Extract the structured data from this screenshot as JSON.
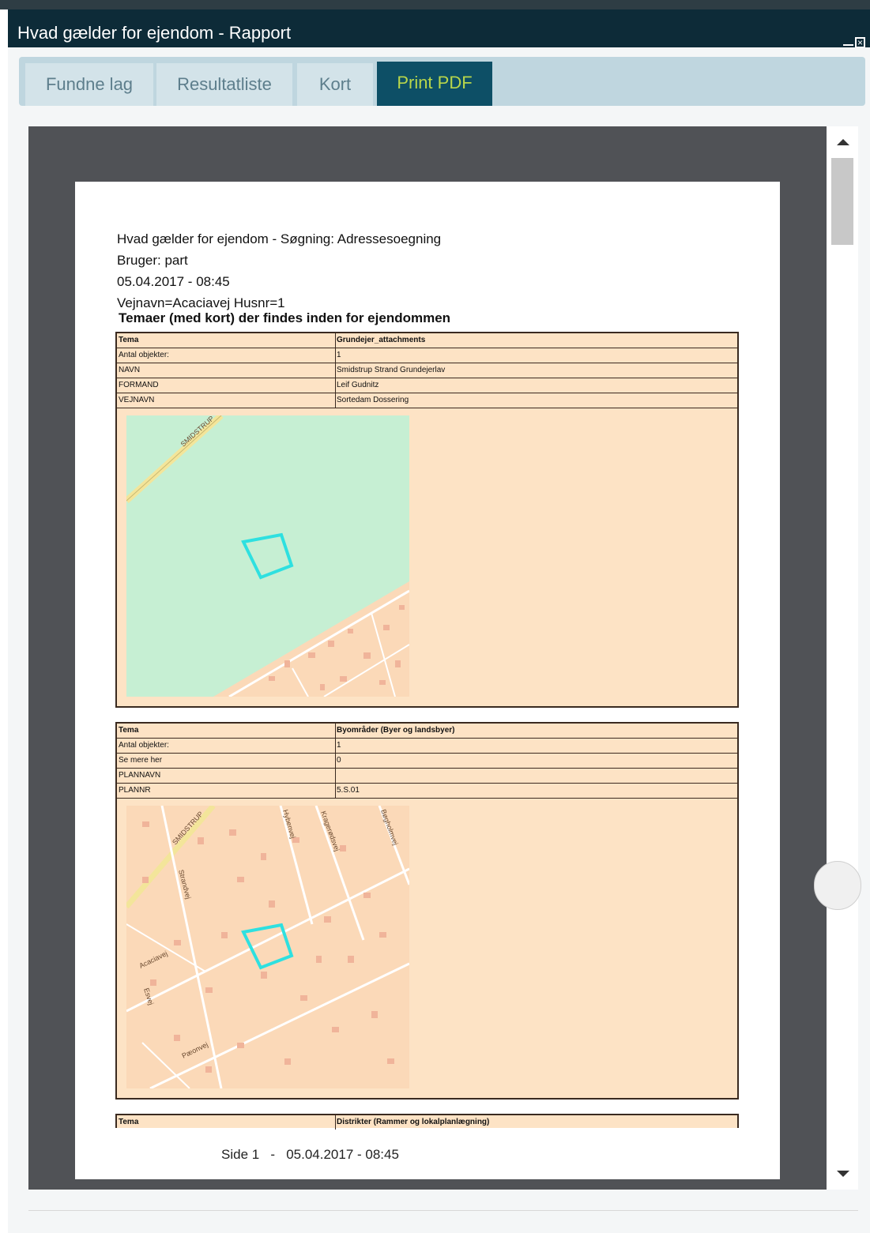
{
  "window": {
    "title": "Hvad gælder for ejendom - Rapport"
  },
  "tabs": [
    {
      "label": "Fundne lag",
      "active": false
    },
    {
      "label": "Resultatliste",
      "active": false
    },
    {
      "label": "Kort",
      "active": false
    },
    {
      "label": "Print PDF",
      "active": true
    }
  ],
  "report": {
    "header_line1": "Hvad gælder for ejendom - Søgning: Adressesoegning",
    "header_line2": "Bruger: part",
    "header_line3": "05.04.2017 - 08:45",
    "header_line4": "Vejnavn=Acaciavej Husnr=1",
    "section_title": "Temaer (med kort) der findes inden for ejendommen",
    "table1": [
      {
        "key": "Tema",
        "value": "Grundejer_attachments"
      },
      {
        "key": "Antal objekter:",
        "value": "1"
      },
      {
        "key": "NAVN",
        "value": "Smidstrup Strand Grundejerlav"
      },
      {
        "key": "FORMAND",
        "value": "Leif Gudnitz"
      },
      {
        "key": "VEJNAVN",
        "value": "Sortedam Dossering"
      }
    ],
    "map1_labels": {
      "road": "SMIDSTRUP"
    },
    "table2": [
      {
        "key": "Tema",
        "value": "Byområder (Byer og landsbyer)"
      },
      {
        "key": "Antal objekter:",
        "value": "1"
      },
      {
        "key": "Se mere her",
        "value": "0"
      },
      {
        "key": "PLANNAVN",
        "value": ""
      },
      {
        "key": "PLANNR",
        "value": "5.S.01"
      }
    ],
    "map2_labels": {
      "road1": "SMIDSTRUP",
      "road2": "Hybenvej",
      "road3": "Kragerødsvej",
      "road4": "Bøgholmvej",
      "road5": "Strandvej",
      "road6": "Acaciavej",
      "road7": "Esvej",
      "road8": "Pæonvej"
    },
    "table3": [
      {
        "key": "Tema",
        "value": "Distrikter (Rammer og lokalplanlægning)"
      }
    ],
    "footer": "Side 1   -   05.04.2017 - 08:45"
  },
  "colors": {
    "titlebar": "#0d2b38",
    "tab_active_bg": "#0d4f66",
    "tab_active_text": "#b8d64b",
    "table_bg": "#fde3c5",
    "property_outline": "#2ee0e0"
  }
}
